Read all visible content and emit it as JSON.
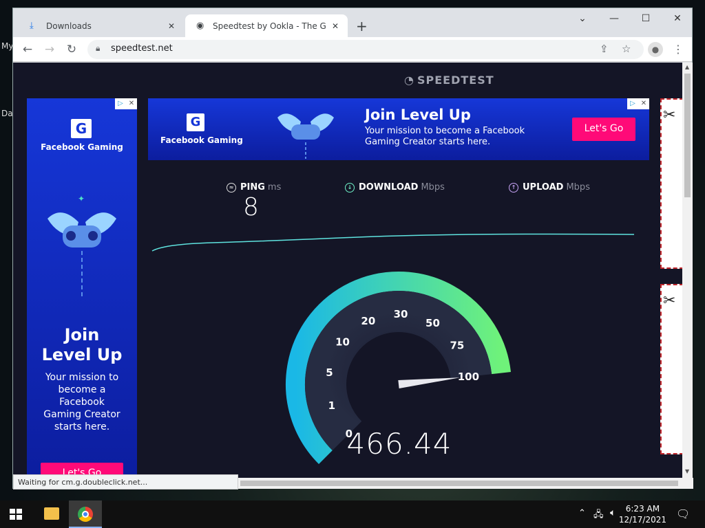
{
  "desktop": {
    "label1": "My",
    "label2": "Da"
  },
  "browser": {
    "tabs": [
      {
        "label": "Downloads",
        "icon": "download-icon"
      },
      {
        "label": "Speedtest by Ookla - The Global",
        "icon": "speedtest-icon"
      }
    ],
    "new_tab": "+",
    "url": "speedtest.net",
    "status_text": "Waiting for cm.g.doubleclick.net..."
  },
  "page": {
    "logo": "SPEEDTEST",
    "ad": {
      "brand": "Facebook Gaming",
      "headline": "Join Level Up",
      "headline_l1": "Join",
      "headline_l2": "Level Up",
      "body": "Your mission to become a Facebook Gaming Creator starts here.",
      "body_top_l1": "Your mission to become a Facebook",
      "body_top_l2": "Gaming Creator starts here.",
      "body_left": [
        "Your mission to",
        "become a",
        "Facebook",
        "Gaming Creator",
        "starts here."
      ],
      "cta": "Let's Go",
      "accent": "#ff0a78",
      "bg": "#1637d8"
    },
    "metrics": [
      {
        "label": "PING",
        "unit": "ms",
        "value": "8"
      },
      {
        "label": "DOWNLOAD",
        "unit": "Mbps"
      },
      {
        "label": "UPLOAD",
        "unit": "Mbps"
      }
    ],
    "gauge": {
      "ticks": [
        "0",
        "1",
        "5",
        "10",
        "20",
        "30",
        "50",
        "75",
        "100"
      ],
      "speed": "466.44",
      "needle_value": 100,
      "colors": {
        "start": "#1ab8e6",
        "end": "#6ff27a"
      }
    }
  },
  "taskbar": {
    "time": "6:23 AM",
    "date": "12/17/2021"
  }
}
